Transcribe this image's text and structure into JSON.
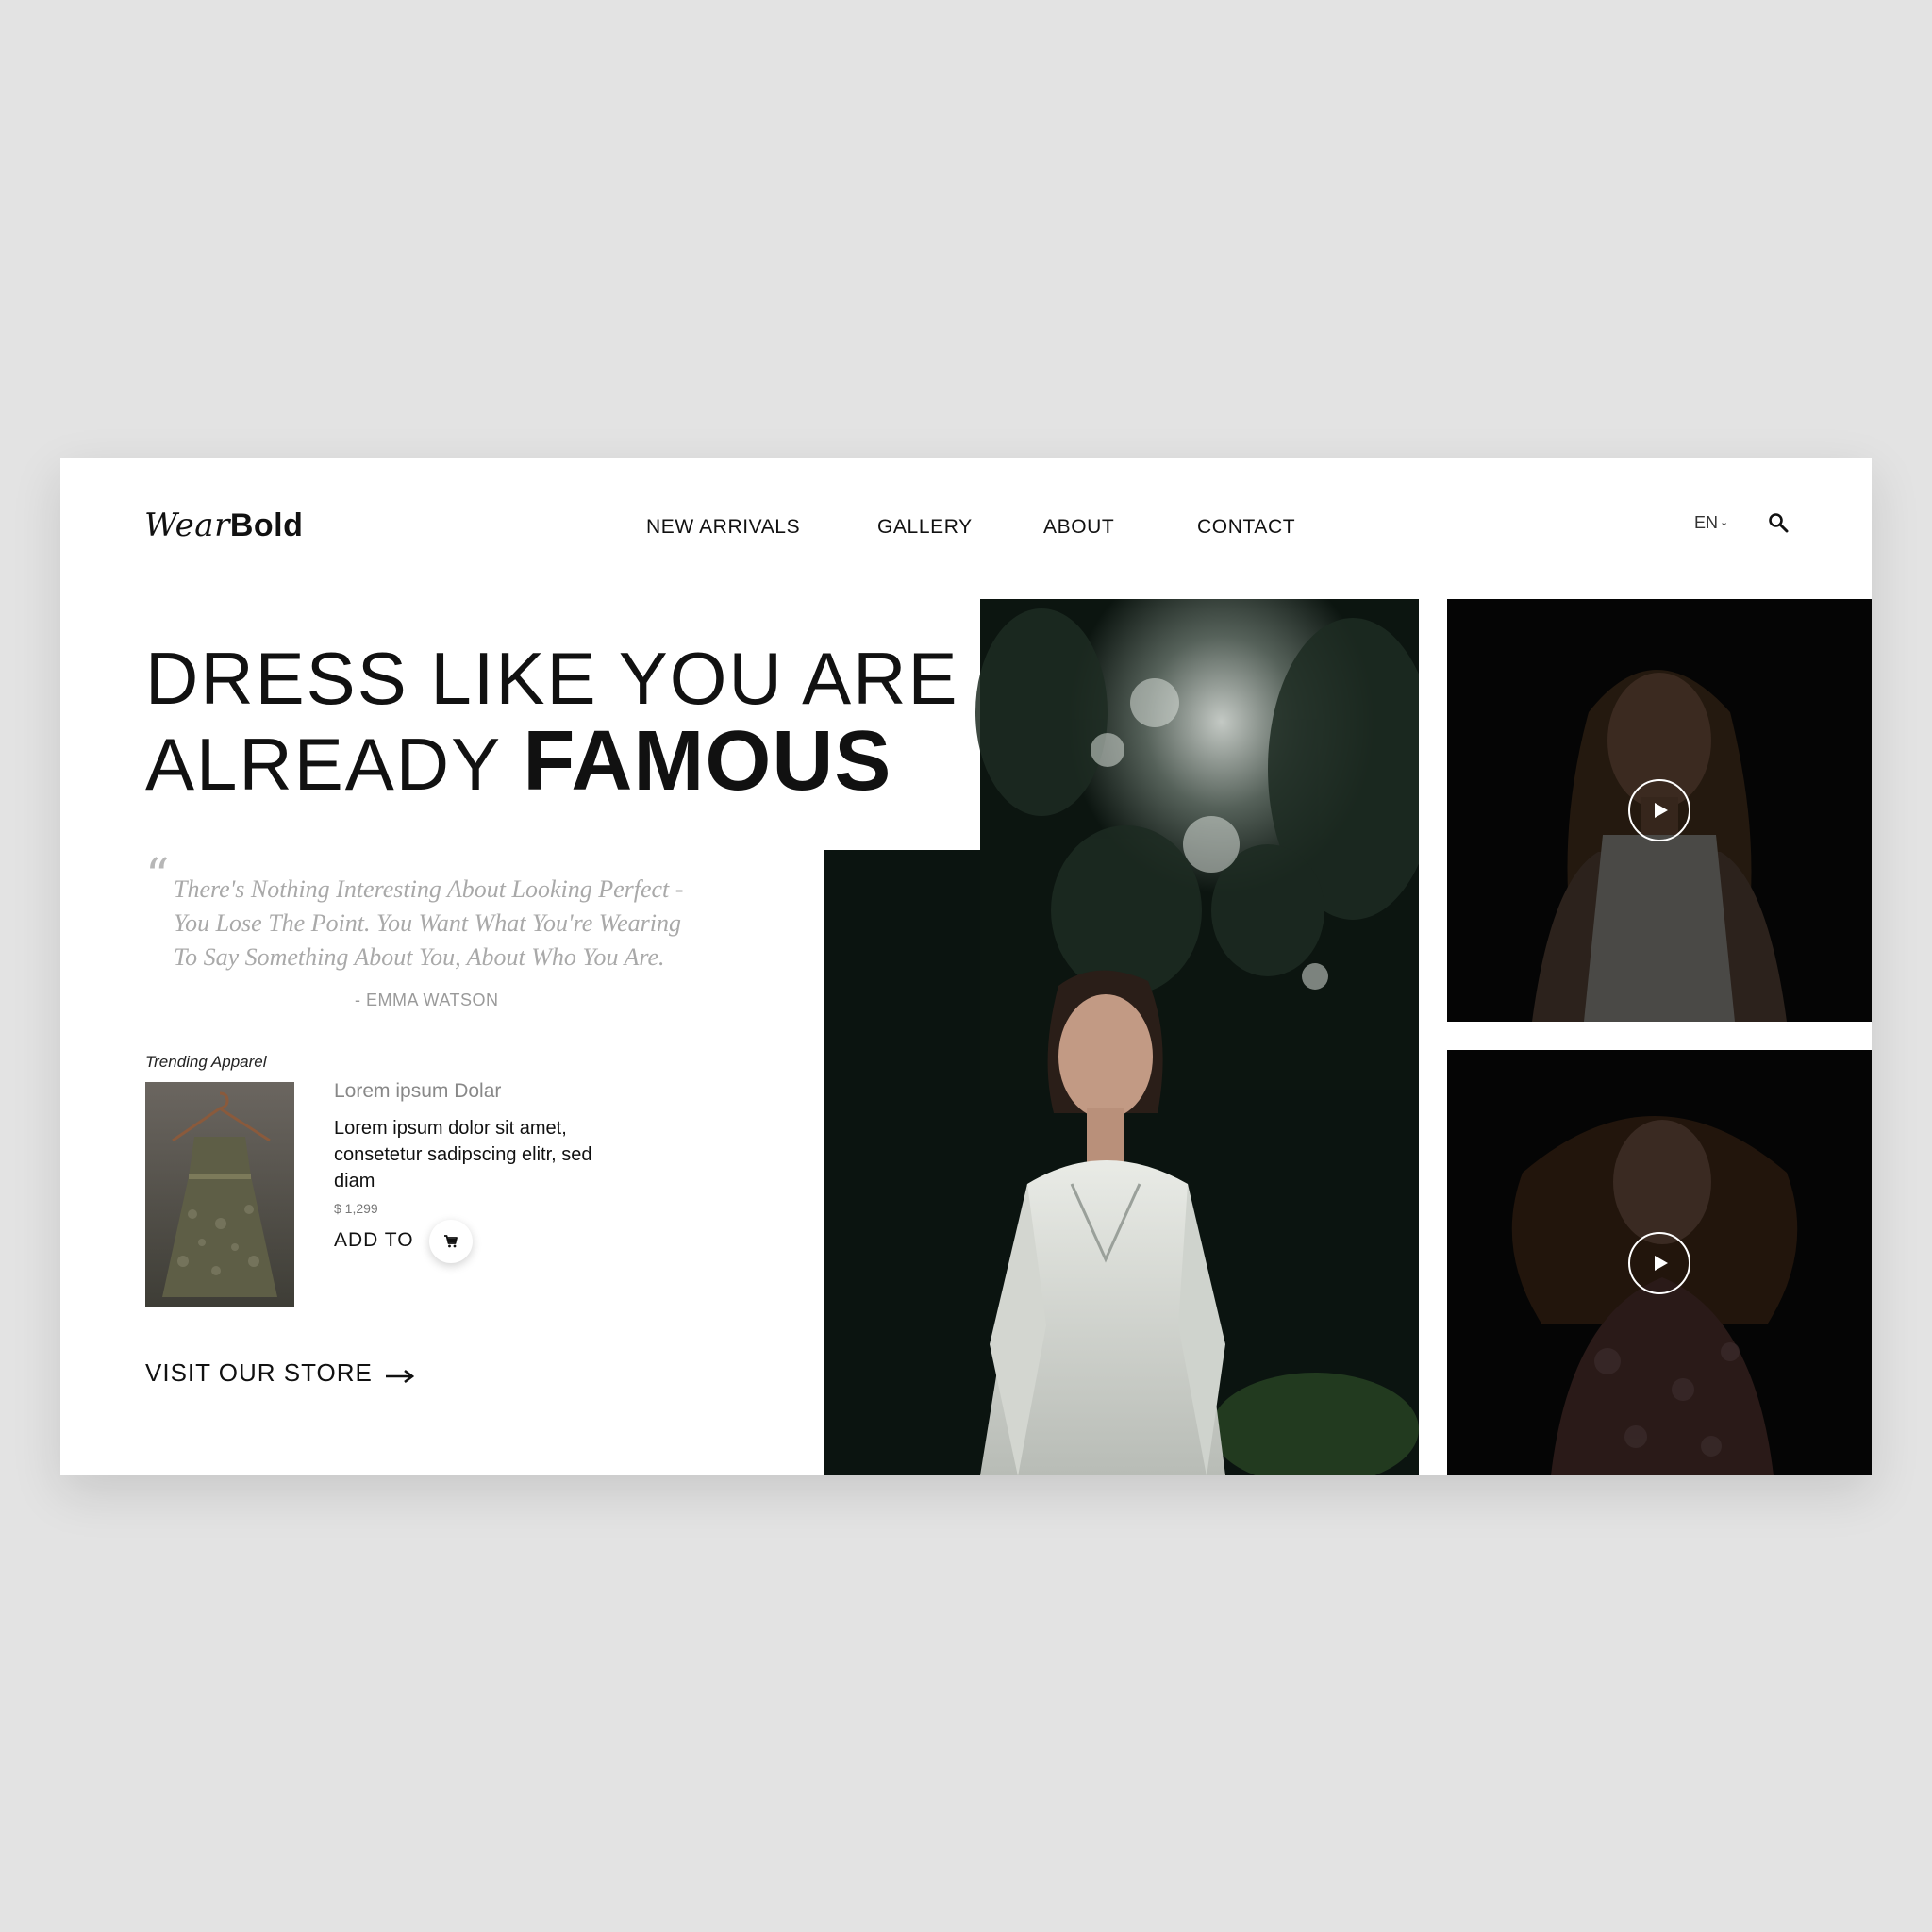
{
  "brand": {
    "wear": "Wear",
    "bold": "Bold"
  },
  "nav": {
    "items": [
      {
        "label": "NEW ARRIVALS"
      },
      {
        "label": "GALLERY"
      },
      {
        "label": "ABOUT"
      },
      {
        "label": "CONTACT"
      }
    ]
  },
  "header": {
    "language": "EN",
    "search_icon": "search-icon"
  },
  "hero": {
    "line1": "DRESS LIKE YOU ARE",
    "line2_prefix": "ALREADY",
    "line2_emphasis": "FAMOUS"
  },
  "quote": {
    "mark": "“",
    "text": "There's Nothing Interesting About Looking Perfect - You Lose The Point. You Want What You're Wearing To Say Something About You, About Who You Are.",
    "author": "- EMMA WATSON"
  },
  "trending": {
    "label": "Trending Apparel",
    "product": {
      "name": "Lorem ipsum Dolar",
      "description": "Lorem ipsum dolor sit amet, consetetur sadipscing elitr, sed diam",
      "price": "$ 1,299",
      "add_label": "ADD TO",
      "cart_icon": "cart-icon"
    }
  },
  "cta": {
    "visit_label": "VISIT OUR STORE",
    "arrow_icon": "arrow-right-icon"
  },
  "media": {
    "main_photo": "woman-in-white-lace-dress-forest",
    "videos": [
      {
        "thumbnail": "woman-in-white-dress-dark",
        "play_icon": "play-icon"
      },
      {
        "thumbnail": "woman-with-flowing-hair-dark",
        "play_icon": "play-icon"
      }
    ]
  },
  "colors": {
    "page_bg": "#e3e3e3",
    "card_bg": "#ffffff",
    "text": "#111111",
    "muted": "#a9a9a9"
  }
}
